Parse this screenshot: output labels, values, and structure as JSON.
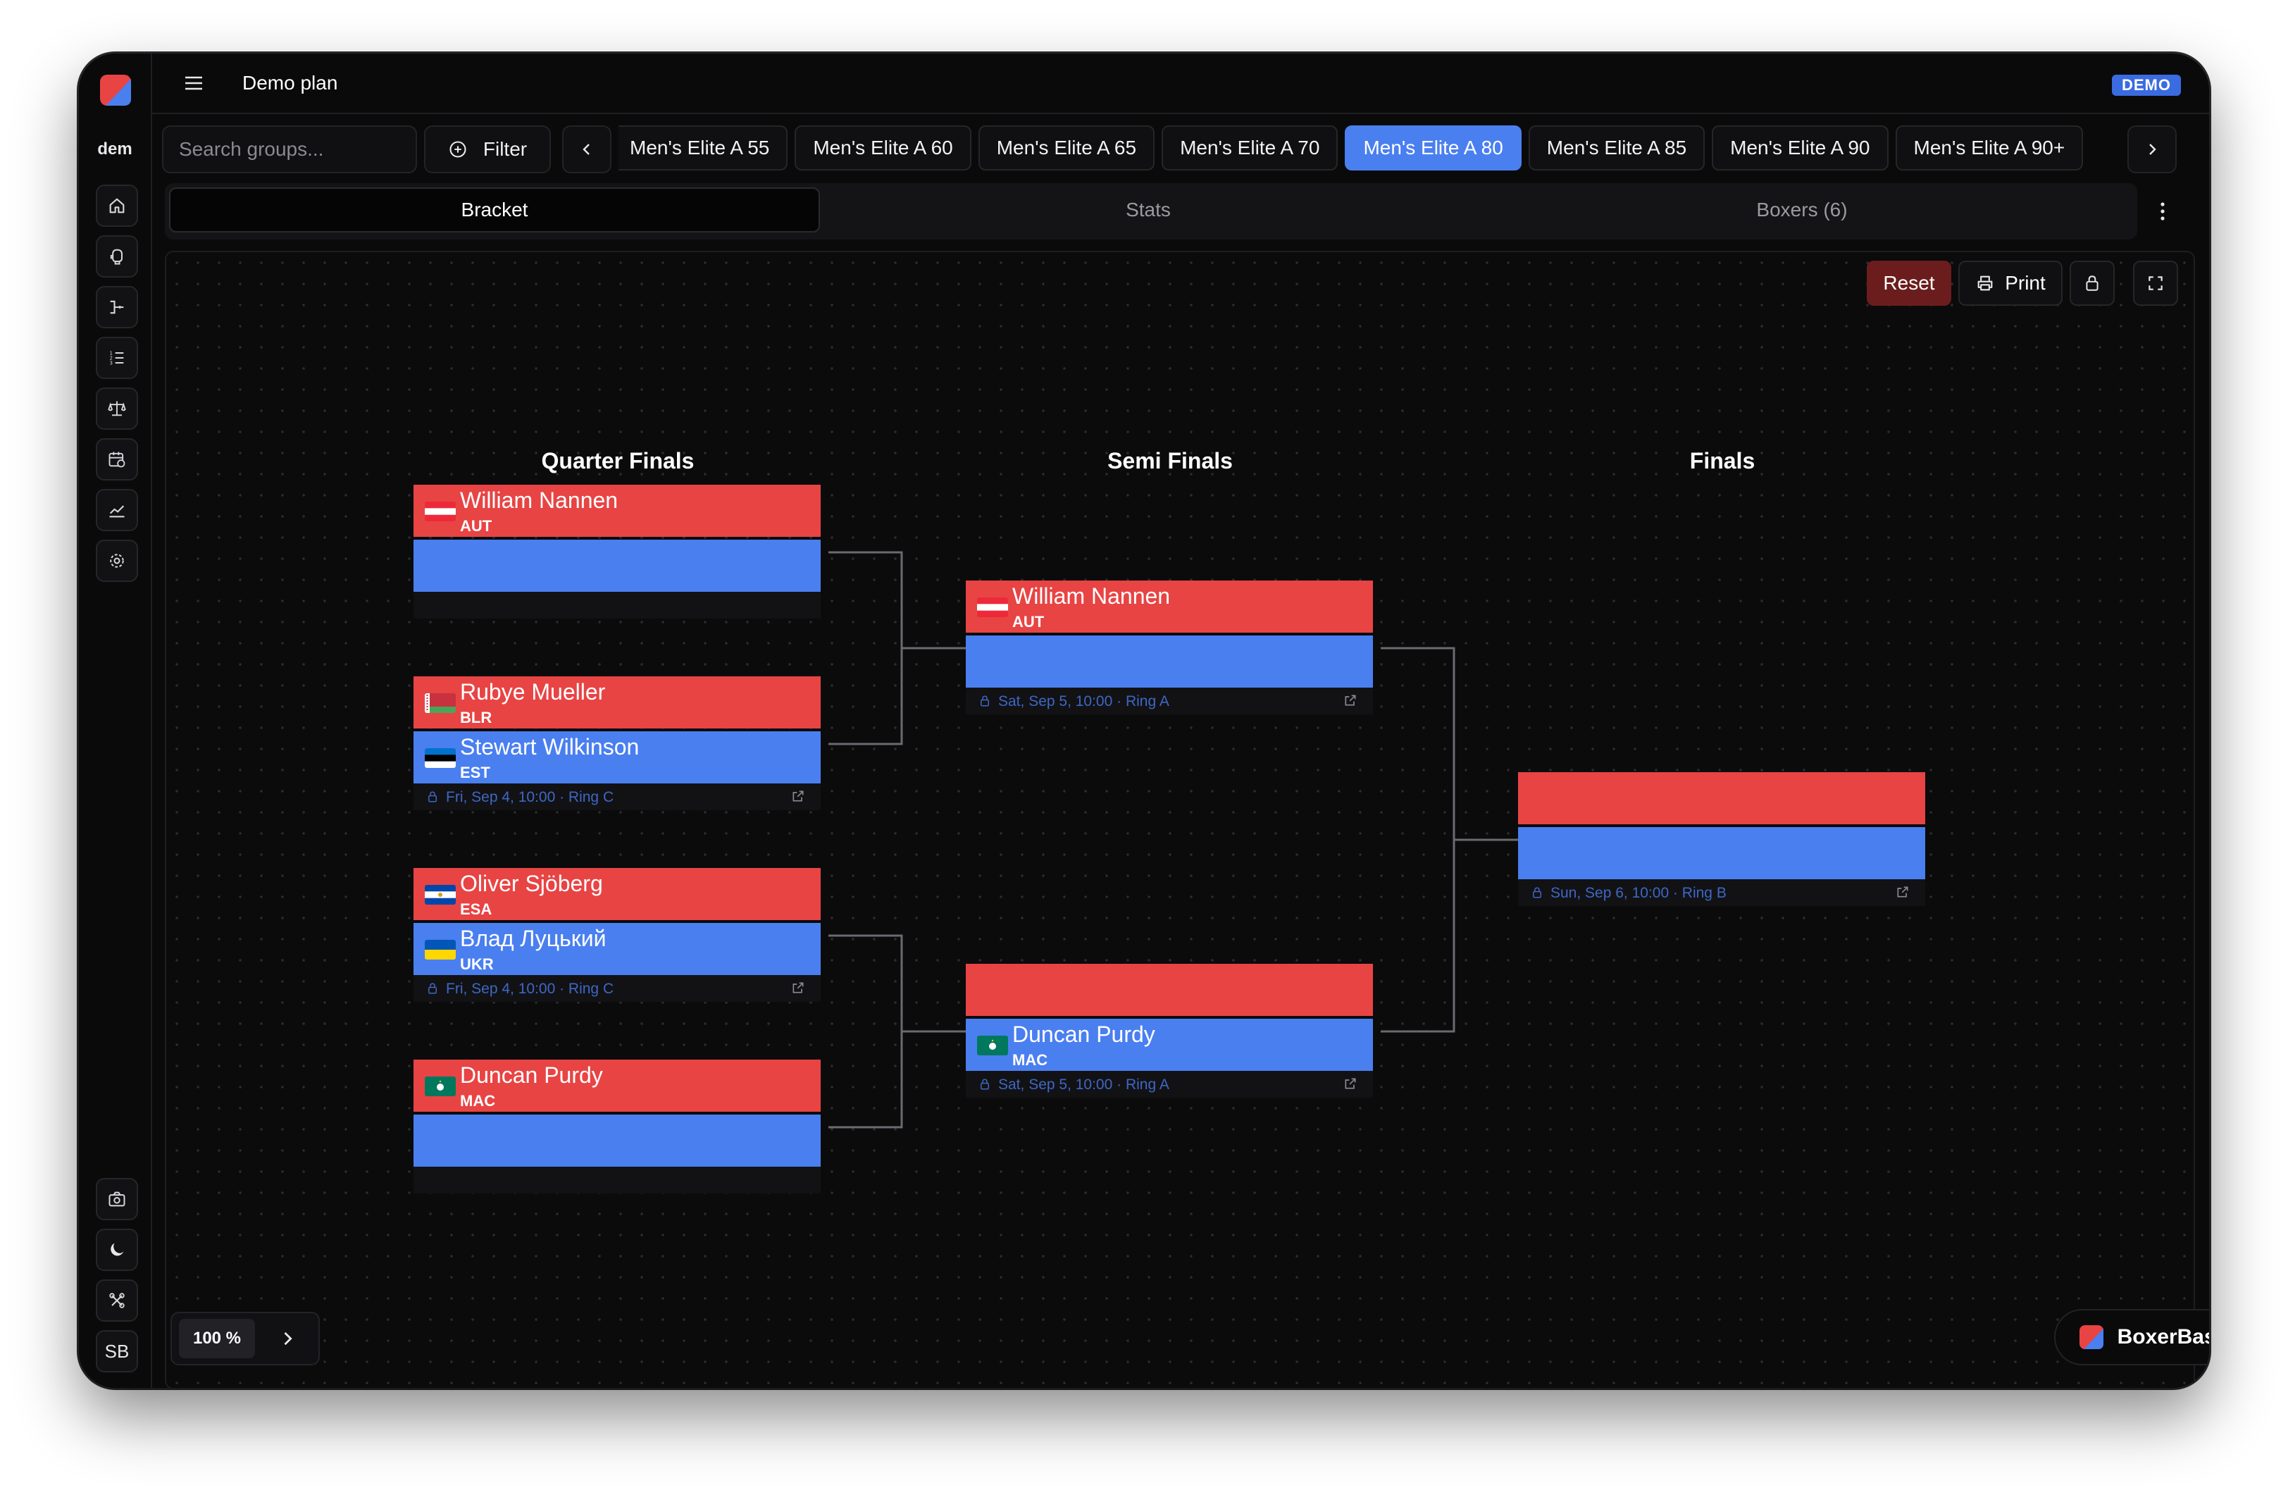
{
  "app": {
    "workspace_short": "dem",
    "plan_title": "Demo plan",
    "badge": "DEMO",
    "user_initials": "SB",
    "accent_blue": "#4a7ff0",
    "accent_red": "#e84444"
  },
  "toolbar": {
    "search_placeholder": "Search groups...",
    "filter_label": "Filter",
    "categories": [
      "Men's Elite A 55",
      "Men's Elite A 60",
      "Men's Elite A 65",
      "Men's Elite A 70",
      "Men's Elite A 80",
      "Men's Elite A 85",
      "Men's Elite A 90",
      "Men's Elite A 90+"
    ],
    "active_category": "Men's Elite A 80"
  },
  "view_tabs": [
    "Bracket",
    "Stats",
    "Boxers (6)"
  ],
  "actions": {
    "reset": "Reset",
    "print": "Print"
  },
  "rounds": [
    "Quarter Finals",
    "Semi Finals",
    "Finals"
  ],
  "bracket": {
    "qf": [
      {
        "red": {
          "name": "William Nannen",
          "country": "AUT"
        },
        "blue": {
          "name": "",
          "country": ""
        },
        "info": ""
      },
      {
        "red": {
          "name": "Rubye Mueller",
          "country": "BLR"
        },
        "blue": {
          "name": "Stewart Wilkinson",
          "country": "EST"
        },
        "info": "Fri, Sep 4, 10:00 · Ring C"
      },
      {
        "red": {
          "name": "Oliver Sjöberg",
          "country": "ESA"
        },
        "blue": {
          "name": "Влад Луцький",
          "country": "UKR"
        },
        "info": "Fri, Sep 4, 10:00 · Ring C"
      },
      {
        "red": {
          "name": "Duncan Purdy",
          "country": "MAC"
        },
        "blue": {
          "name": "",
          "country": ""
        },
        "info": ""
      }
    ],
    "sf": [
      {
        "red": {
          "name": "William Nannen",
          "country": "AUT"
        },
        "blue": {
          "name": "",
          "country": ""
        },
        "info": "Sat, Sep 5, 10:00 · Ring A"
      },
      {
        "red": {
          "name": "",
          "country": ""
        },
        "blue": {
          "name": "Duncan Purdy",
          "country": "MAC"
        },
        "info": "Sat, Sep 5, 10:00 · Ring A"
      }
    ],
    "final": {
      "red": {
        "name": "",
        "country": ""
      },
      "blue": {
        "name": "",
        "country": ""
      },
      "info": "Sun, Sep 6, 10:00 · Ring B"
    }
  },
  "zoom": {
    "value": "100 %"
  },
  "brand": {
    "name": "BoxerBase"
  }
}
